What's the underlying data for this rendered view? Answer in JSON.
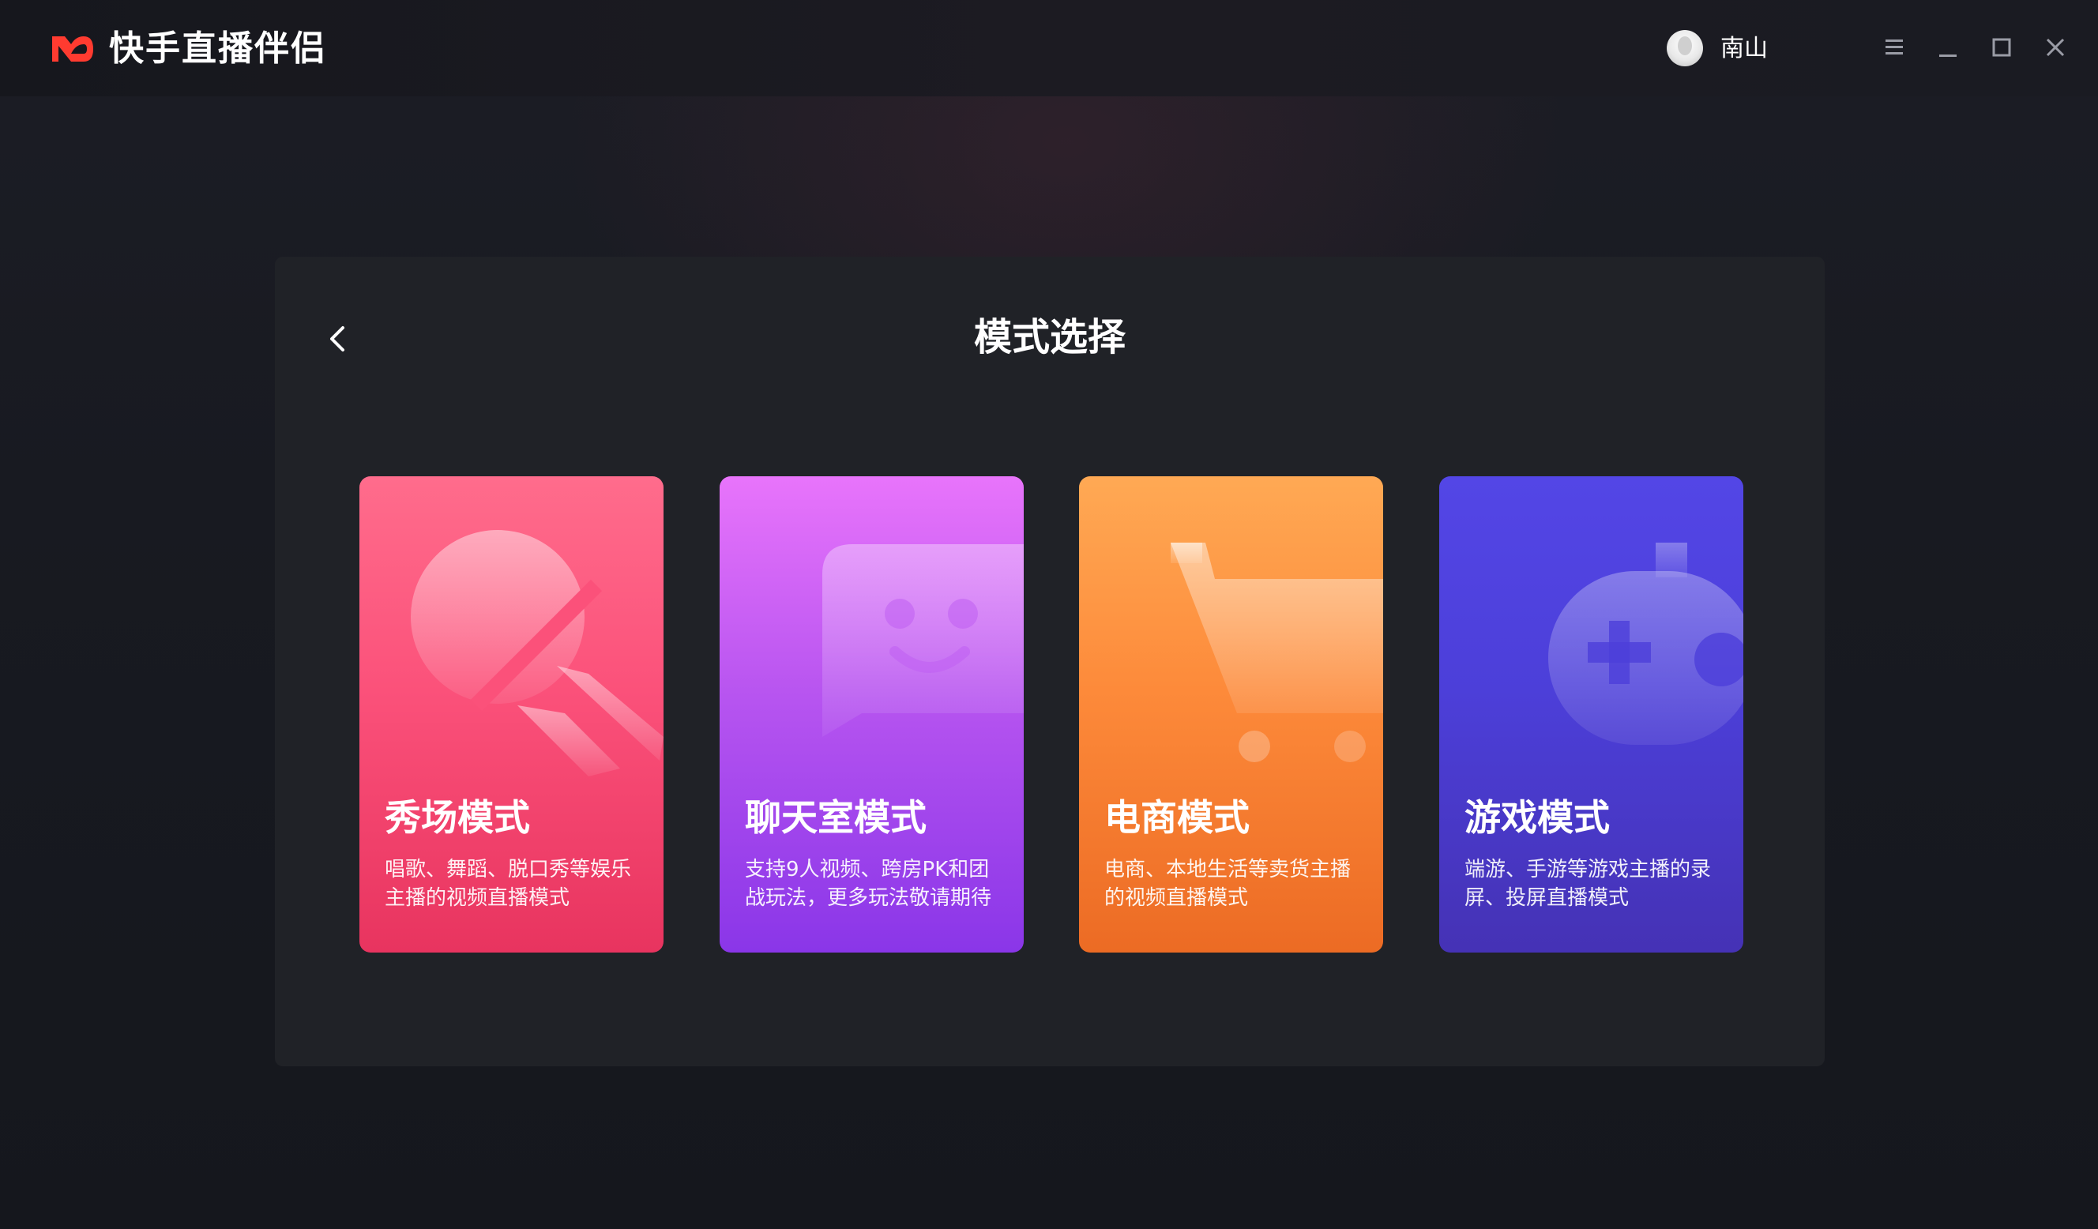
{
  "app": {
    "title": "快手直播伴侣"
  },
  "user": {
    "name": "南山"
  },
  "window_controls": {
    "icons": [
      "menu-icon",
      "minimize-icon",
      "maximize-icon",
      "close-icon"
    ]
  },
  "panel": {
    "title": "模式选择",
    "back_icon": "chevron-left-icon"
  },
  "modes": [
    {
      "title": "秀场模式",
      "desc": "唱歌、舞蹈、脱口秀等娱乐主播的视频直播模式",
      "icon": "microphone-icon",
      "color": "#fb517a"
    },
    {
      "title": "聊天室模式",
      "desc": "支持9人视频、跨房PK和团战玩法，更多玩法敬请期待",
      "icon": "chat-bubble-icon",
      "color": "#b855f0"
    },
    {
      "title": "电商模式",
      "desc": "电商、本地生活等卖货主播的视频直播模式",
      "icon": "shopping-cart-icon",
      "color": "#fd8a3a"
    },
    {
      "title": "游戏模式",
      "desc": "端游、手游等游戏主播的录屏、投屏直播模式",
      "icon": "gamepad-icon",
      "color": "#4c3fd9"
    }
  ]
}
